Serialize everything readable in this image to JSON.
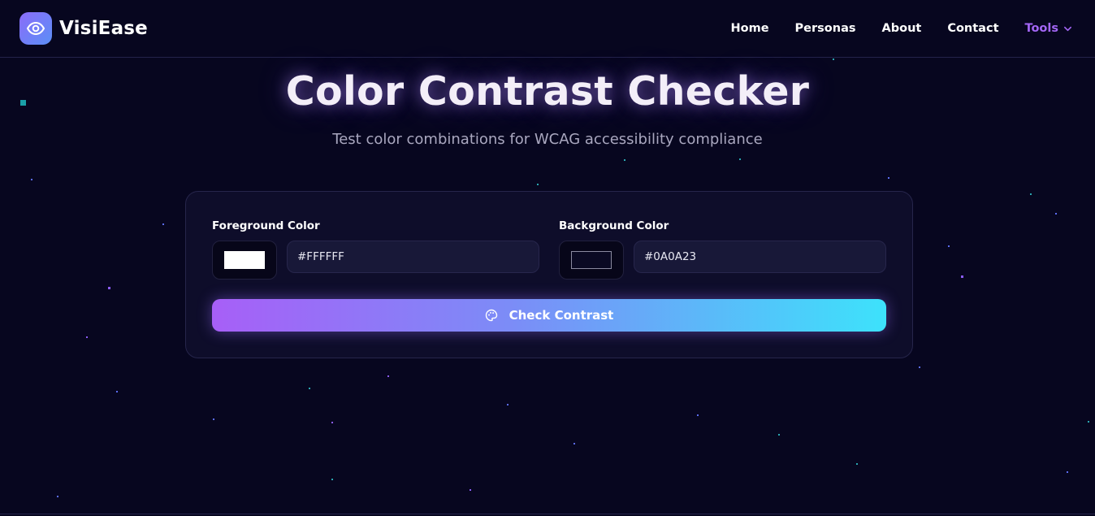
{
  "brand": {
    "name": "VisiEase",
    "logo_icon": "eye-icon"
  },
  "nav": {
    "home": "Home",
    "personas": "Personas",
    "about": "About",
    "contact": "Contact",
    "tools": "Tools",
    "tools_icon": "chevron-down-icon"
  },
  "hero": {
    "title": "Color Contrast Checker",
    "subtitle": "Test color combinations for WCAG accessibility compliance"
  },
  "checker": {
    "foreground": {
      "label": "Foreground Color",
      "value": "#FFFFFF",
      "swatch_color": "#FFFFFF"
    },
    "background": {
      "label": "Background Color",
      "value": "#0A0A23",
      "swatch_color": "#0A0A23"
    },
    "button_label": "Check Contrast",
    "button_icon": "palette-icon"
  },
  "colors": {
    "page_bg": "#07061F",
    "accent_purple": "#A366F5",
    "accent_cyan": "#3DE2FB"
  }
}
